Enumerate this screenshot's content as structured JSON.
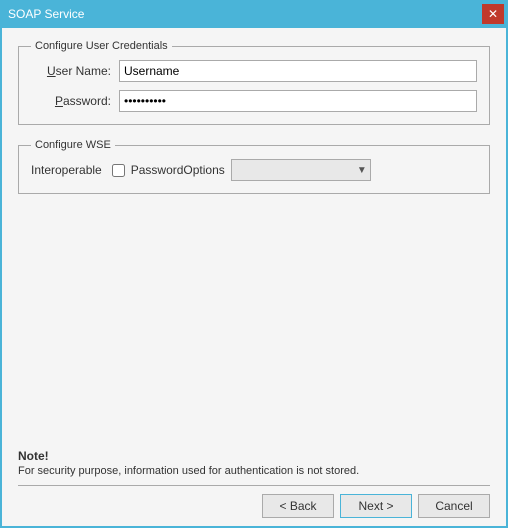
{
  "titlebar": {
    "title": "SOAP Service",
    "close_label": "✕"
  },
  "credentials_group": {
    "legend": "Configure User Credentials",
    "username_label": "User Name:",
    "username_underline": "U",
    "username_value": "Username",
    "password_label": "Password:",
    "password_underline": "P",
    "password_value": "••••••••••"
  },
  "wse_group": {
    "legend": "Configure WSE",
    "interoperable_label": "Interoperable",
    "password_options_label": "PasswordOptions"
  },
  "note": {
    "title": "Note!",
    "text": "For security purpose, information used for authentication is not stored."
  },
  "buttons": {
    "back_label": "< Back",
    "next_label": "Next >",
    "cancel_label": "Cancel"
  }
}
